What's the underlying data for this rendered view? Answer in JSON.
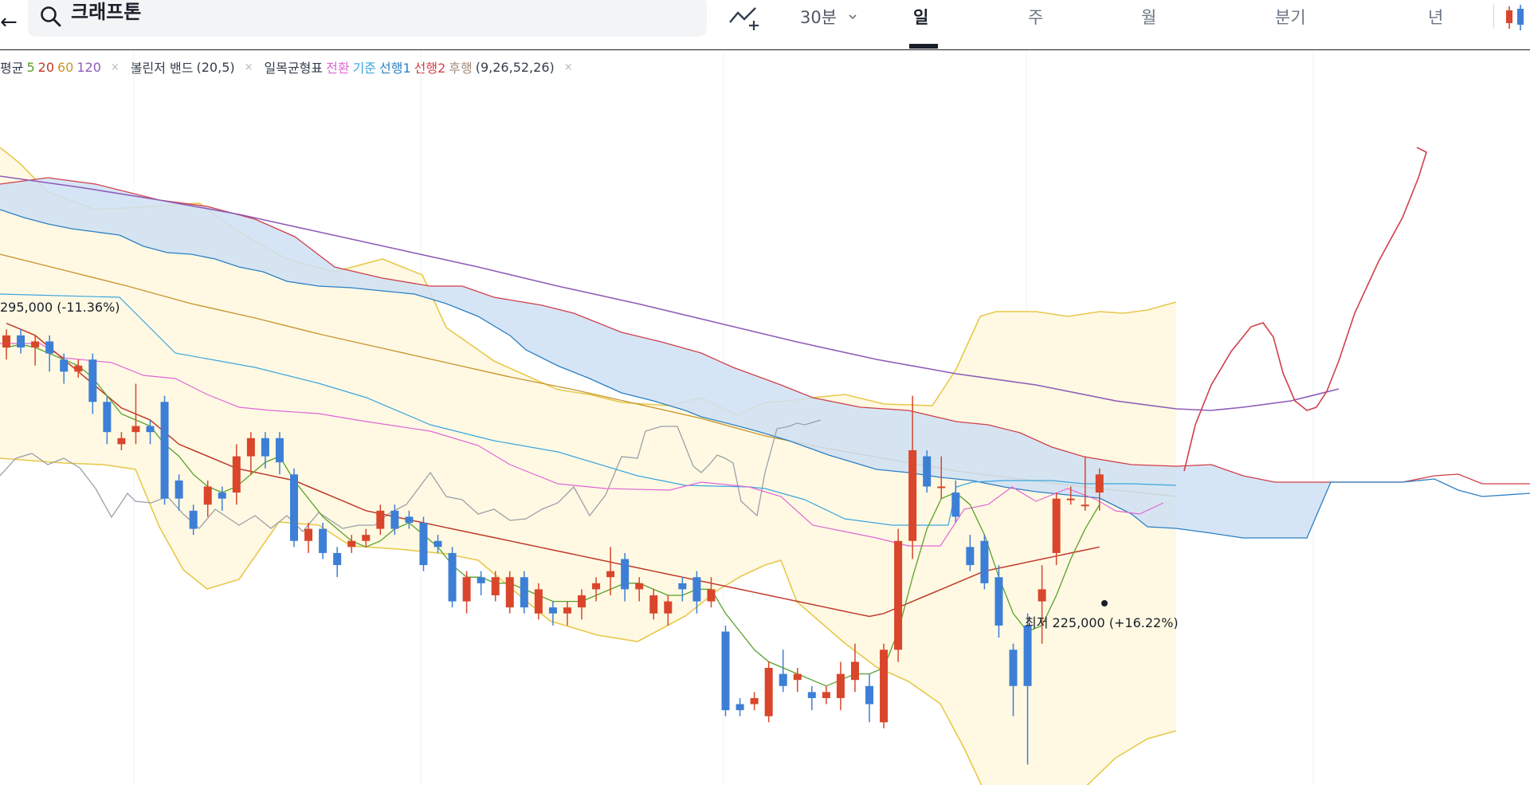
{
  "header": {
    "back_glyph": "←",
    "search_text": "크래프톤",
    "interval_label": "30분",
    "tabs": [
      "일",
      "주",
      "월",
      "분기",
      "년"
    ],
    "active_tab": "일"
  },
  "legend": {
    "ma": {
      "name": "평균",
      "periods": [
        "5",
        "20",
        "60",
        "120"
      ],
      "colors": [
        "#5aa02c",
        "#c0392b",
        "#c8962e",
        "#8e5bb8"
      ]
    },
    "bollinger": {
      "name": "볼린저 밴드",
      "params": "(20,5)"
    },
    "ichimoku": {
      "name": "일목균형표",
      "items": [
        "전환",
        "기준",
        "선행1",
        "선행2",
        "후행"
      ],
      "colors": [
        "#e066d6",
        "#3aa6dd",
        "#2b7fc4",
        "#d13f4a",
        "#a08a7a"
      ],
      "params": "(9,26,52,26)"
    },
    "close_glyph": "×"
  },
  "annotations": {
    "high_label": "295,000 (-11.36%)",
    "low_label": "최저   225,000 (+16.22%)"
  },
  "colors": {
    "up": "#d9462b",
    "down": "#3d7fd6",
    "cloud_blue": "#cfe0f5",
    "band_fill": "#fff9e3",
    "band_line": "#e8c84a"
  },
  "chart_data": {
    "type": "candlestick",
    "candles": [
      [
        266000,
        268000,
        264000,
        269000
      ],
      [
        268000,
        266000,
        265000,
        269000
      ],
      [
        266000,
        267000,
        263000,
        268000
      ],
      [
        267000,
        265000,
        262000,
        268000
      ],
      [
        264000,
        262000,
        260000,
        265000
      ],
      [
        262000,
        263000,
        261000,
        264000
      ],
      [
        264000,
        257000,
        255000,
        265000
      ],
      [
        257000,
        252000,
        250000,
        258000
      ],
      [
        250000,
        251000,
        249000,
        252000
      ],
      [
        252000,
        253000,
        250000,
        260000
      ],
      [
        253000,
        252000,
        250000,
        254000
      ],
      [
        257000,
        241000,
        240000,
        258000
      ],
      [
        244000,
        241000,
        239000,
        245000
      ],
      [
        239000,
        236000,
        235000,
        240000
      ],
      [
        240000,
        243000,
        238000,
        244000
      ],
      [
        242000,
        241000,
        239000,
        243000
      ],
      [
        242000,
        248000,
        240000,
        250000
      ],
      [
        248000,
        251000,
        245000,
        252000
      ],
      [
        251000,
        248000,
        246000,
        252000
      ],
      [
        251000,
        247000,
        245000,
        252000
      ],
      [
        245000,
        234000,
        233000,
        246000
      ],
      [
        234000,
        236000,
        232000,
        237000
      ],
      [
        236000,
        232000,
        231000,
        237000
      ],
      [
        232000,
        230000,
        228000,
        233000
      ],
      [
        233000,
        234000,
        232000,
        235000
      ],
      [
        234000,
        235000,
        233000,
        236000
      ],
      [
        236000,
        239000,
        235000,
        240000
      ],
      [
        239000,
        236000,
        235000,
        240000
      ],
      [
        238000,
        237000,
        236000,
        239000
      ],
      [
        237000,
        230000,
        229000,
        238000
      ],
      [
        234000,
        233000,
        232000,
        235000
      ],
      [
        232000,
        224000,
        223000,
        233000
      ],
      [
        224000,
        228000,
        222000,
        229000
      ],
      [
        228000,
        227000,
        225000,
        229000
      ],
      [
        225000,
        228000,
        224000,
        229000
      ],
      [
        223000,
        228000,
        222000,
        229000
      ],
      [
        228000,
        223000,
        222000,
        229000
      ],
      [
        222000,
        226000,
        221000,
        227000
      ],
      [
        223000,
        222000,
        220000,
        224000
      ],
      [
        222000,
        223000,
        220000,
        224000
      ],
      [
        223000,
        225000,
        221000,
        226000
      ],
      [
        226000,
        227000,
        224000,
        228000
      ],
      [
        228000,
        229000,
        225000,
        233000
      ],
      [
        231000,
        226000,
        224000,
        232000
      ],
      [
        226000,
        227000,
        224000,
        228000
      ],
      [
        222000,
        225000,
        221000,
        226000
      ],
      [
        222000,
        224000,
        220000,
        225000
      ],
      [
        227000,
        226000,
        224000,
        228000
      ],
      [
        228000,
        224000,
        222000,
        229000
      ],
      [
        224000,
        226000,
        223000,
        228000
      ],
      [
        219000,
        206000,
        205000,
        220000
      ],
      [
        207000,
        206000,
        205000,
        208000
      ],
      [
        207000,
        208000,
        206000,
        209000
      ],
      [
        205000,
        213000,
        204000,
        214000
      ],
      [
        212000,
        210000,
        209000,
        216000
      ],
      [
        211000,
        212000,
        209000,
        213000
      ],
      [
        209000,
        208000,
        206000,
        210000
      ],
      [
        208000,
        209000,
        207000,
        210000
      ],
      [
        208000,
        212000,
        206000,
        214000
      ],
      [
        211000,
        214000,
        209000,
        217000
      ],
      [
        210000,
        207000,
        204000,
        212000
      ],
      [
        204000,
        216000,
        203000,
        217000
      ],
      [
        216000,
        234000,
        214000,
        236000
      ],
      [
        234000,
        249000,
        231000,
        258000
      ],
      [
        248000,
        243000,
        242000,
        249000
      ],
      [
        243000,
        243000,
        241000,
        248000
      ],
      [
        242000,
        238000,
        237000,
        244000
      ],
      [
        233000,
        230000,
        229000,
        235000
      ],
      [
        234000,
        227000,
        226000,
        235000
      ],
      [
        228000,
        220000,
        218000,
        230000
      ],
      [
        216000,
        210000,
        205000,
        217000
      ],
      [
        220000,
        210000,
        197000,
        222000
      ],
      [
        224000,
        226000,
        217000,
        230000
      ],
      [
        232000,
        241000,
        230000,
        242000
      ],
      [
        241000,
        241000,
        240000,
        243000
      ],
      [
        240000,
        240000,
        239000,
        248000
      ],
      [
        242000,
        245000,
        239000,
        246000
      ]
    ],
    "overlays": {
      "ma120": [
        291000,
        290000,
        289000,
        288000,
        287000,
        286000,
        285000,
        284000,
        283000,
        282000,
        281000,
        280000,
        279000,
        278000,
        277000,
        276000,
        275000,
        274000,
        273000,
        272000,
        271000,
        270000,
        269000,
        268000,
        267000,
        266000,
        265000,
        264000,
        263000,
        262000,
        261000,
        260500,
        260000,
        259500,
        259000,
        258500,
        258000,
        257000,
        256000,
        255000,
        254000,
        253500,
        253000,
        252500,
        252000,
        251500,
        251000,
        250500,
        250000,
        249500,
        249000,
        248500,
        248000,
        247500,
        247000,
        246500,
        246000,
        245500,
        245000,
        244500,
        244000,
        243500,
        243000,
        242500,
        242000,
        241500,
        241000,
        240500,
        240000,
        239500,
        239000,
        238500,
        238000,
        237500,
        237000,
        236500,
        236000
      ],
      "ma60": [
        277000,
        276000,
        275000,
        274000,
        273000,
        272000,
        271000,
        270000,
        269000,
        268000,
        267000,
        266000,
        265000,
        264000,
        263000,
        262000,
        261000,
        260000,
        259000,
        258000,
        257000,
        256000,
        255000,
        254000,
        253000,
        252000,
        251000,
        250000,
        249000,
        248000,
        247000,
        246000,
        245000,
        244000,
        243000,
        242500,
        242000,
        241500,
        241000,
        240500,
        240000,
        239500,
        239000,
        238500,
        238000,
        237500,
        237000,
        236500,
        236000,
        235500,
        235000,
        234500,
        234000,
        233500,
        233000,
        232500,
        232000,
        231500,
        231000,
        230500,
        230000,
        229500,
        229000,
        228500,
        228000,
        227500,
        227000,
        226500,
        226000,
        225500,
        225000,
        224500,
        224000,
        223500,
        223000,
        222500,
        222000
      ],
      "ma20": [
        270000,
        269000,
        268000,
        266000,
        264000,
        262000,
        260000,
        258000,
        256000,
        255000,
        254000,
        252000,
        250000,
        249000,
        248000,
        247000,
        246000,
        245500,
        245000,
        244500,
        244000,
        243000,
        242000,
        241000,
        240000,
        239000,
        238500,
        238000,
        237500,
        237000,
        236500,
        236000,
        235500,
        235000,
        234500,
        234000,
        233500,
        233000,
        232500,
        232000,
        231500,
        231000,
        230500,
        230000,
        229500,
        229000,
        228500,
        228000,
        227500,
        227000,
        226500,
        226000,
        225500,
        225000,
        224500,
        224000,
        223500,
        223000,
        222500,
        222000,
        221500,
        222000,
        223000,
        224000,
        225000,
        226000,
        227000,
        228000,
        229000,
        229500,
        230000,
        230500,
        231000,
        231500,
        232000,
        232500,
        233000
      ],
      "ma5": [
        266000,
        266500,
        266000,
        265000,
        264000,
        263000,
        261000,
        258000,
        255000,
        254000,
        253000,
        250000,
        248000,
        245000,
        243000,
        242000,
        243000,
        245000,
        247000,
        248000,
        244000,
        241000,
        238000,
        236000,
        234000,
        233000,
        234000,
        236000,
        237000,
        235000,
        233000,
        230000,
        228000,
        228000,
        227000,
        227000,
        226000,
        225000,
        224000,
        224000,
        224000,
        225000,
        226000,
        227000,
        227000,
        226000,
        225000,
        225000,
        226000,
        226000,
        222000,
        219000,
        216000,
        214000,
        213000,
        212000,
        211000,
        210000,
        211000,
        212000,
        212000,
        213000,
        219000,
        228000,
        236000,
        241000,
        242000,
        240000,
        235000,
        228000,
        222000,
        219000,
        220000,
        225000,
        231000,
        236000,
        240000
      ]
    },
    "ylabel": "",
    "xlabel": ""
  }
}
